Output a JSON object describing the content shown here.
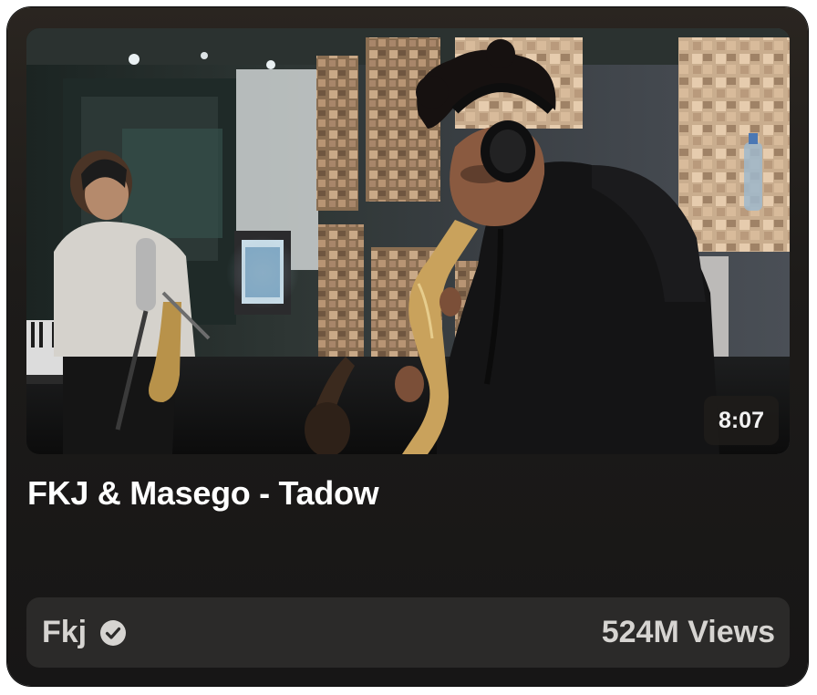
{
  "video": {
    "title": "FKJ & Masego - Tadow",
    "duration": "8:07",
    "channel": "Fkj",
    "views": "524M Views",
    "thumbnail_icon": "video-thumbnail"
  },
  "icons": {
    "verified": "check-circle-icon"
  },
  "colors": {
    "card_background": "#1d1b19",
    "footer_background": "#2b2a29",
    "title_text": "#ffffff",
    "meta_text": "#d6d4d1"
  }
}
